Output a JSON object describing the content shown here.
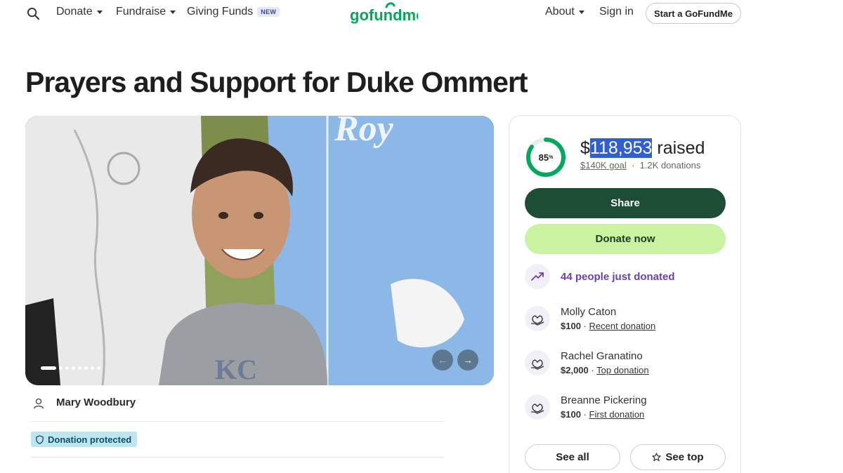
{
  "header": {
    "donate_label": "Donate",
    "fundraise_label": "Fundraise",
    "giving_funds_label": "Giving Funds",
    "giving_funds_badge": "NEW",
    "logo_text": "gofundme",
    "about_label": "About",
    "sign_in_label": "Sign in",
    "start_label": "Start a GoFundMe"
  },
  "campaign": {
    "title": "Prayers and Support for Duke Ommert",
    "organizer": "Mary Woodbury",
    "protected_label": "Donation protected",
    "carousel": {
      "slide_count": 8,
      "active_slide": 1
    }
  },
  "progress": {
    "percent": 85,
    "percent_label": "85",
    "percent_unit": "%",
    "currency": "$",
    "amount": "118,953",
    "raised_word": " raised",
    "goal": "$140K goal",
    "separator": "·",
    "donations": "1.2K donations"
  },
  "actions": {
    "share_label": "Share",
    "donate_now_label": "Donate now",
    "see_all_label": "See all",
    "see_top_label": "See top"
  },
  "activity": {
    "recent_count_text": "44 people just donated"
  },
  "donors": [
    {
      "name": "Molly Caton",
      "amount": "$100",
      "separator": "·",
      "tag": "Recent donation"
    },
    {
      "name": "Rachel Granatino",
      "amount": "$2,000",
      "separator": "·",
      "tag": "Top donation"
    },
    {
      "name": "Breanne Pickering",
      "amount": "$100",
      "separator": "·",
      "tag": "First donation"
    }
  ],
  "colors": {
    "brand_green": "#02a95c",
    "share_bg": "#1e4d36",
    "donate_bg": "#c9f2a1",
    "accent_purple": "#6b3fb0",
    "protected_bg": "#bfe6f0"
  }
}
